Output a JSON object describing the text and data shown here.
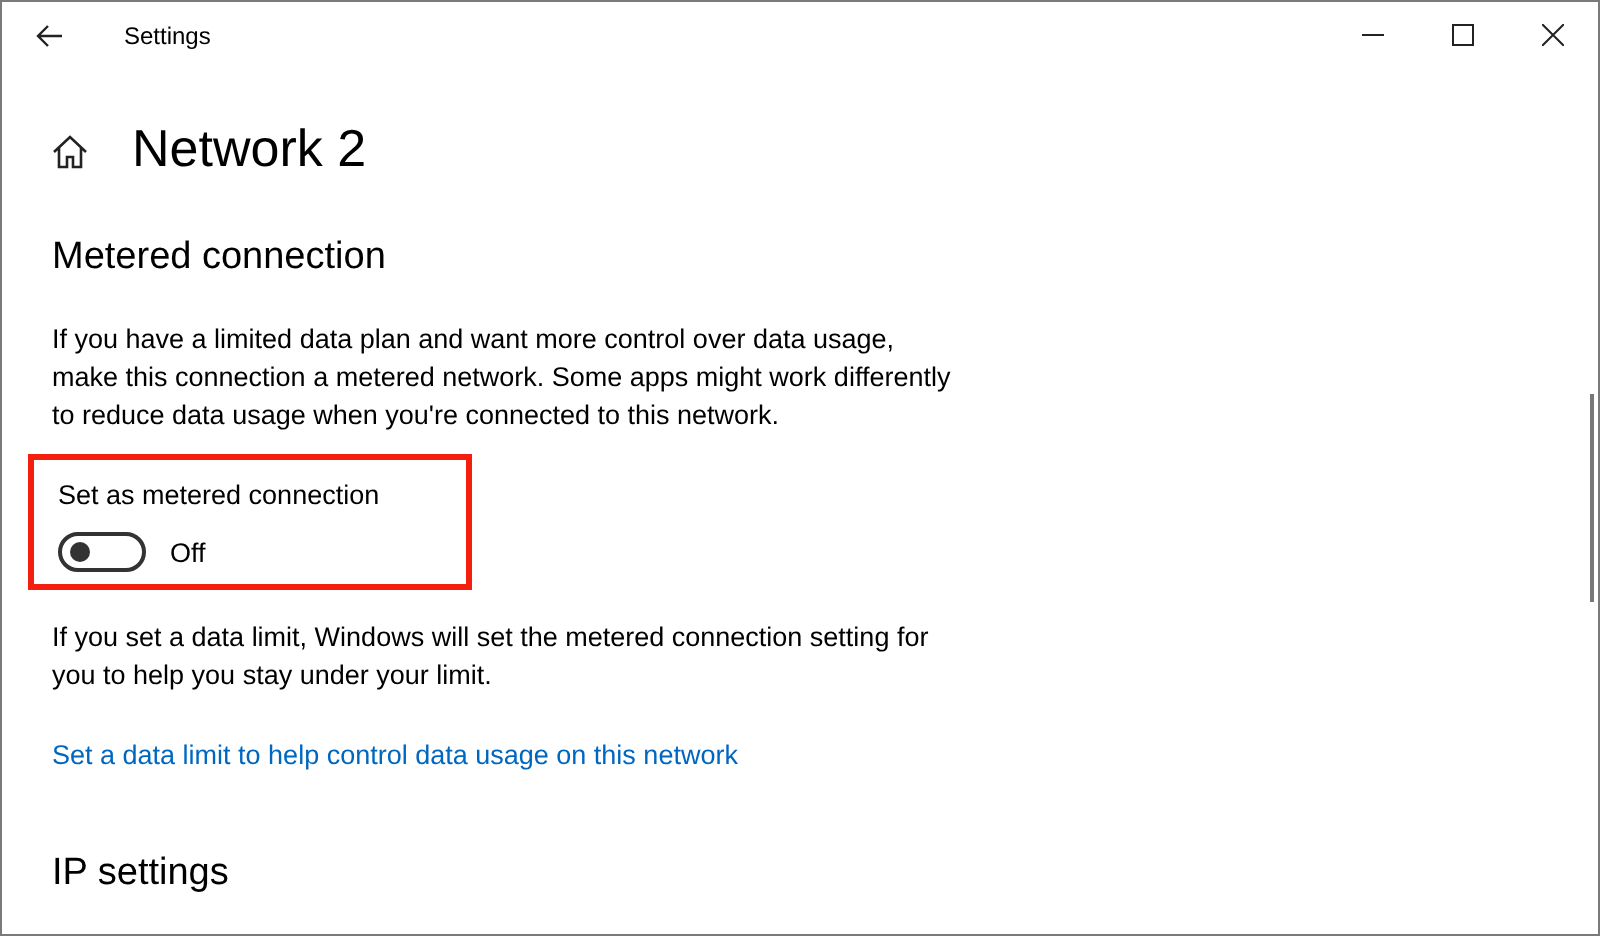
{
  "window": {
    "title": "Settings"
  },
  "page": {
    "title": "Network 2"
  },
  "metered": {
    "heading": "Metered connection",
    "description": "If you have a limited data plan and want more control over data usage, make this connection a metered network. Some apps might work differently to reduce data usage when you're connected to this network.",
    "highlighted": true,
    "toggle": {
      "label": "Set as metered connection",
      "on": false,
      "state_text": "Off"
    },
    "note": "If you set a data limit, Windows will set the metered connection setting for you to help you stay under your limit.",
    "link": "Set a data limit to help control data usage on this network"
  },
  "ip_settings": {
    "heading": "IP settings"
  }
}
